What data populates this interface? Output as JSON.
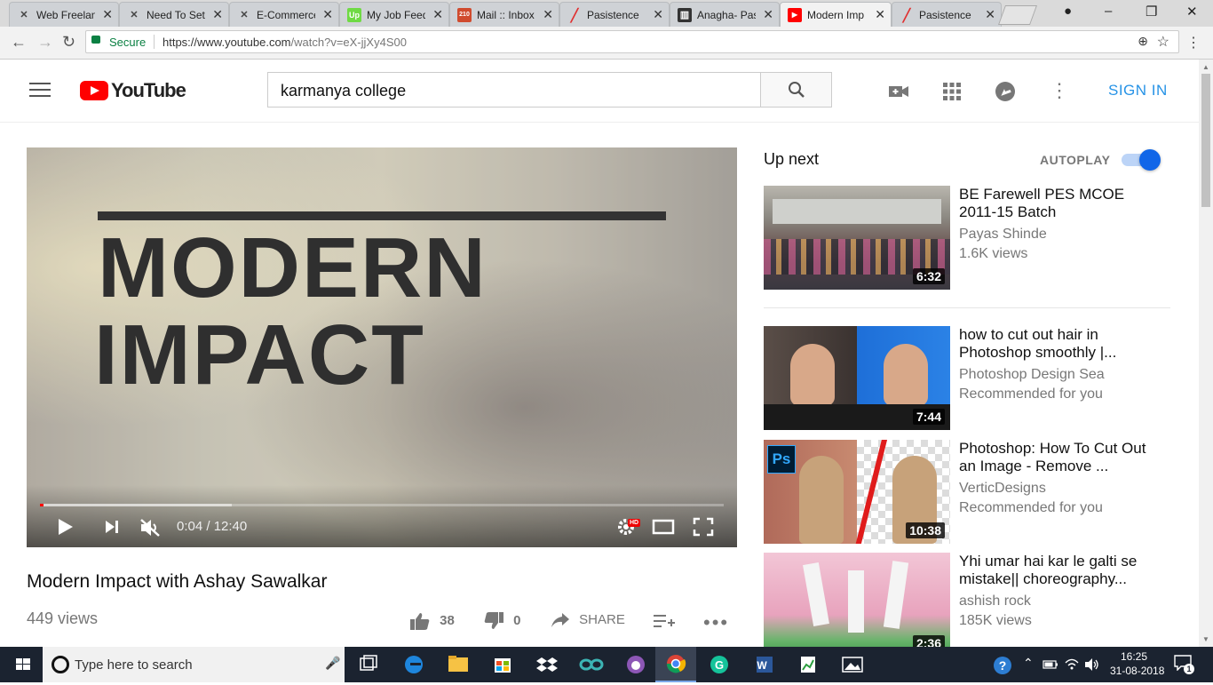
{
  "browser": {
    "tabs": [
      {
        "label": "Web Freelan",
        "icon": "freelancer-icon",
        "color": "#444444"
      },
      {
        "label": "Need To Set",
        "icon": "freelancer-icon",
        "color": "#444444"
      },
      {
        "label": "E-Commerce",
        "icon": "freelancer-icon",
        "color": "#444444"
      },
      {
        "label": "My Job Feed",
        "icon": "upwork-icon",
        "color": "#6fda44",
        "glyph": "Up"
      },
      {
        "label": "Mail :: Inbox",
        "icon": "mail-icon",
        "color": "#d04b2e",
        "glyph": "210"
      },
      {
        "label": "Pasistence",
        "icon": "pasistence-icon",
        "color": "#e03030"
      },
      {
        "label": "Anagha- Pas",
        "icon": "trello-icon",
        "color": "#333333"
      },
      {
        "label": "Modern Imp",
        "icon": "youtube-tab-icon",
        "color": "#ff0000"
      },
      {
        "label": "Pasistence",
        "icon": "pasistence-icon",
        "color": "#e03030"
      }
    ],
    "active_tab": 7,
    "address": {
      "secure_label": "Secure",
      "url_host": "https://www.youtube.com",
      "url_path": "/watch?v=eX-jjXy4S00"
    }
  },
  "youtube": {
    "logo_text": "YouTube",
    "search_value": "karmanya college",
    "search_placeholder": "Search",
    "signin_label": "SIGN IN"
  },
  "player": {
    "overlay_line1": "MODERN",
    "overlay_line2": "IMPACT",
    "time_display": "0:04 / 12:40",
    "played_fraction": 0.005,
    "buffered_fraction": 0.28,
    "hd_badge": "HD"
  },
  "video": {
    "title": "Modern Impact with Ashay Sawalkar",
    "views": "449 views",
    "likes": "38",
    "dislikes": "0",
    "share_label": "SHARE"
  },
  "sidebar": {
    "up_next_label": "Up next",
    "autoplay_label": "AUTOPLAY",
    "autoplay_on": true,
    "accent_color": "#1166e8",
    "items": [
      {
        "title": "BE Farewell PES MCOE 2011-15 Batch",
        "channel": "Payas Shinde",
        "meta": "1.6K views",
        "duration": "6:32"
      },
      {
        "title": "how to cut out hair in Photoshop smoothly |...",
        "channel": "Photoshop Design Sea",
        "meta": "Recommended for you",
        "duration": "7:44"
      },
      {
        "title": "Photoshop: How To Cut Out an Image - Remove ...",
        "channel": "VerticDesigns",
        "meta": "Recommended for you",
        "duration": "10:38"
      },
      {
        "title": "Yhi umar hai kar le galti se mistake|| choreography...",
        "channel": "ashish rock",
        "meta": "185K views",
        "duration": "2:36"
      }
    ]
  },
  "taskbar": {
    "search_placeholder": "Type here to search",
    "time": "16:25",
    "date": "31-08-2018",
    "notification_count": "1"
  }
}
